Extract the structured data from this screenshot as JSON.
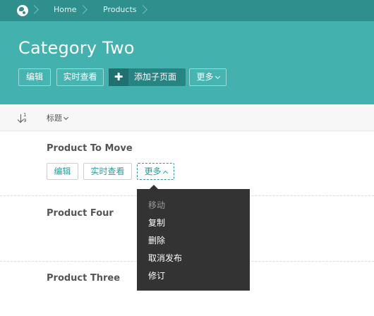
{
  "breadcrumb": {
    "icon": "globe-icon",
    "items": [
      "Home",
      "Products"
    ]
  },
  "header": {
    "title": "Category Two",
    "buttons": {
      "edit": "编辑",
      "live_view": "实时查看",
      "add_child_page": "添加子页面",
      "more": "更多"
    }
  },
  "list": {
    "sort_icon": "sort-numeric-icon",
    "sort_digits": "1\n9",
    "column_title": "标题",
    "rows": [
      {
        "title": "Product To Move",
        "actions": {
          "edit": "编辑",
          "live_view": "实时查看",
          "more": "更多"
        }
      },
      {
        "title": "Product Four"
      },
      {
        "title": "Product Three"
      }
    ]
  },
  "dropdown": {
    "items": [
      {
        "label": "移动",
        "disabled": true
      },
      {
        "label": "复制"
      },
      {
        "label": "删除"
      },
      {
        "label": "取消发布"
      },
      {
        "label": "修订"
      }
    ]
  },
  "colors": {
    "breadcrumb_bg": "#2e8f8c",
    "header_bg": "#43b2ae",
    "accent": "#2e9b97",
    "dropdown_bg": "#333333"
  }
}
